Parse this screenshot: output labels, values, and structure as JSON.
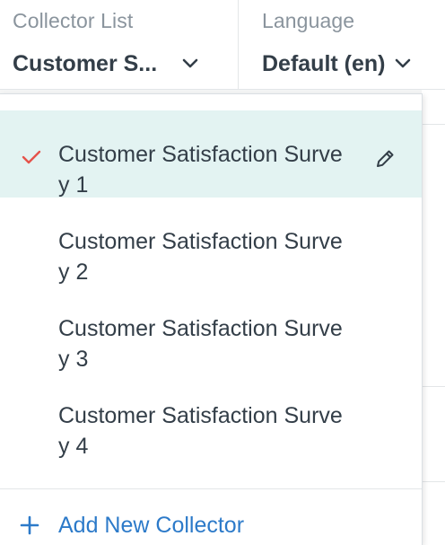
{
  "header": {
    "collector": {
      "label": "Collector List",
      "value": "Customer S..."
    },
    "language": {
      "label": "Language",
      "value": "Default (en)"
    }
  },
  "dropdown": {
    "items": [
      {
        "label": "Customer Satisfaction Survey 1",
        "selected": true
      },
      {
        "label": "Customer Satisfaction Survey 2",
        "selected": false
      },
      {
        "label": "Customer Satisfaction Survey 3",
        "selected": false
      },
      {
        "label": "Customer Satisfaction Survey 4",
        "selected": false
      }
    ],
    "add_label": "Add New Collector"
  },
  "icons": {
    "selected": "check-icon",
    "edit": "pencil-icon",
    "add": "plus-icon",
    "dropdown": "chevron-down-icon"
  },
  "colors": {
    "accent_check": "#e5534b",
    "selected_bg": "#e3f3f2",
    "link_blue": "#2c7ac9",
    "muted_label": "#8a949d",
    "text": "#333e48"
  }
}
